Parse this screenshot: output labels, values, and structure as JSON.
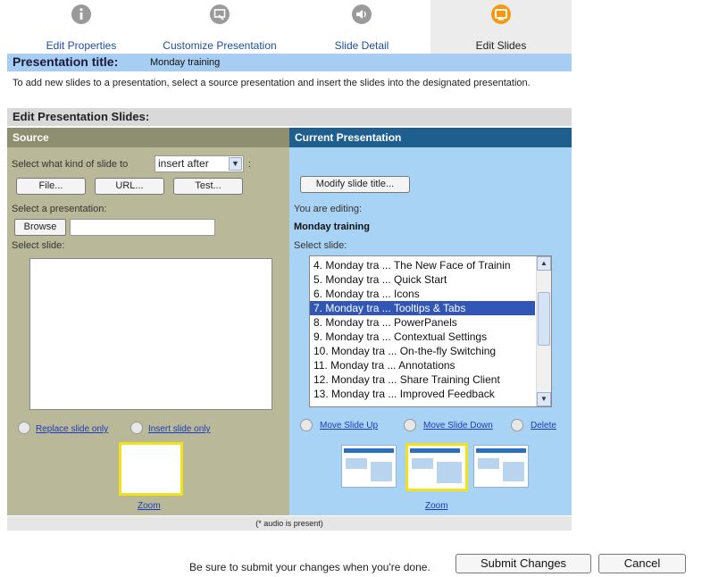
{
  "steps": [
    {
      "label": "Edit Properties",
      "icon": "info-icon",
      "active": false
    },
    {
      "label": "Customize Presentation",
      "icon": "customize-icon",
      "active": false
    },
    {
      "label": "Slide Detail",
      "icon": "speaker-icon",
      "active": false
    },
    {
      "label": "Edit Slides",
      "icon": "slides-icon",
      "active": true
    }
  ],
  "title_bar": {
    "key": "Presentation title:",
    "value": "Monday training"
  },
  "intro": "To add new slides to a presentation, select a source presentation and insert the slides into the designated presentation.",
  "edit_header": "Edit Presentation Slides:",
  "source": {
    "header": "Source",
    "kind_label": "Select what kind of slide to",
    "kind_suffix": ":",
    "kind_value": "insert after",
    "buttons": {
      "file": "File...",
      "url": "URL...",
      "test": "Test..."
    },
    "select_presentation": "Select a presentation:",
    "browse": "Browse",
    "select_slide": "Select slide:",
    "replace_only": "Replace slide only",
    "insert_only": "Insert slide only",
    "zoom": "Zoom"
  },
  "current": {
    "header": "Current Presentation",
    "modify_button": "Modify slide title...",
    "editing_label": "You are editing:",
    "editing_name": "Monday training",
    "select_slide": "Select slide:",
    "slides": [
      "4. Monday tra ... The New Face of Trainin",
      "5. Monday tra ... Quick Start",
      "6. Monday tra ... Icons",
      "7. Monday tra ... Tooltips & Tabs",
      "8. Monday tra ... PowerPanels",
      "9. Monday tra ... Contextual Settings",
      "10. Monday tra ... On-the-fly Switching",
      "11. Monday tra ... Annotations",
      "12. Monday tra ... Share Training Client",
      "13. Monday tra ... Improved Feedback"
    ],
    "selected_index": 3,
    "move_up": "Move Slide Up",
    "move_down": "Move Slide Down",
    "delete": "Delete",
    "zoom": "Zoom"
  },
  "footer_note": "(* audio is present)",
  "bottom": {
    "message": "Be sure to submit your changes when you're done.",
    "submit": "Submit Changes",
    "cancel": "Cancel"
  },
  "colors": {
    "source_bg": "#b9b99a",
    "current_bg": "#a8d3f4",
    "active_step_icon": "#f39a12",
    "link": "#1c3bbb",
    "selection": "#3256b6"
  }
}
